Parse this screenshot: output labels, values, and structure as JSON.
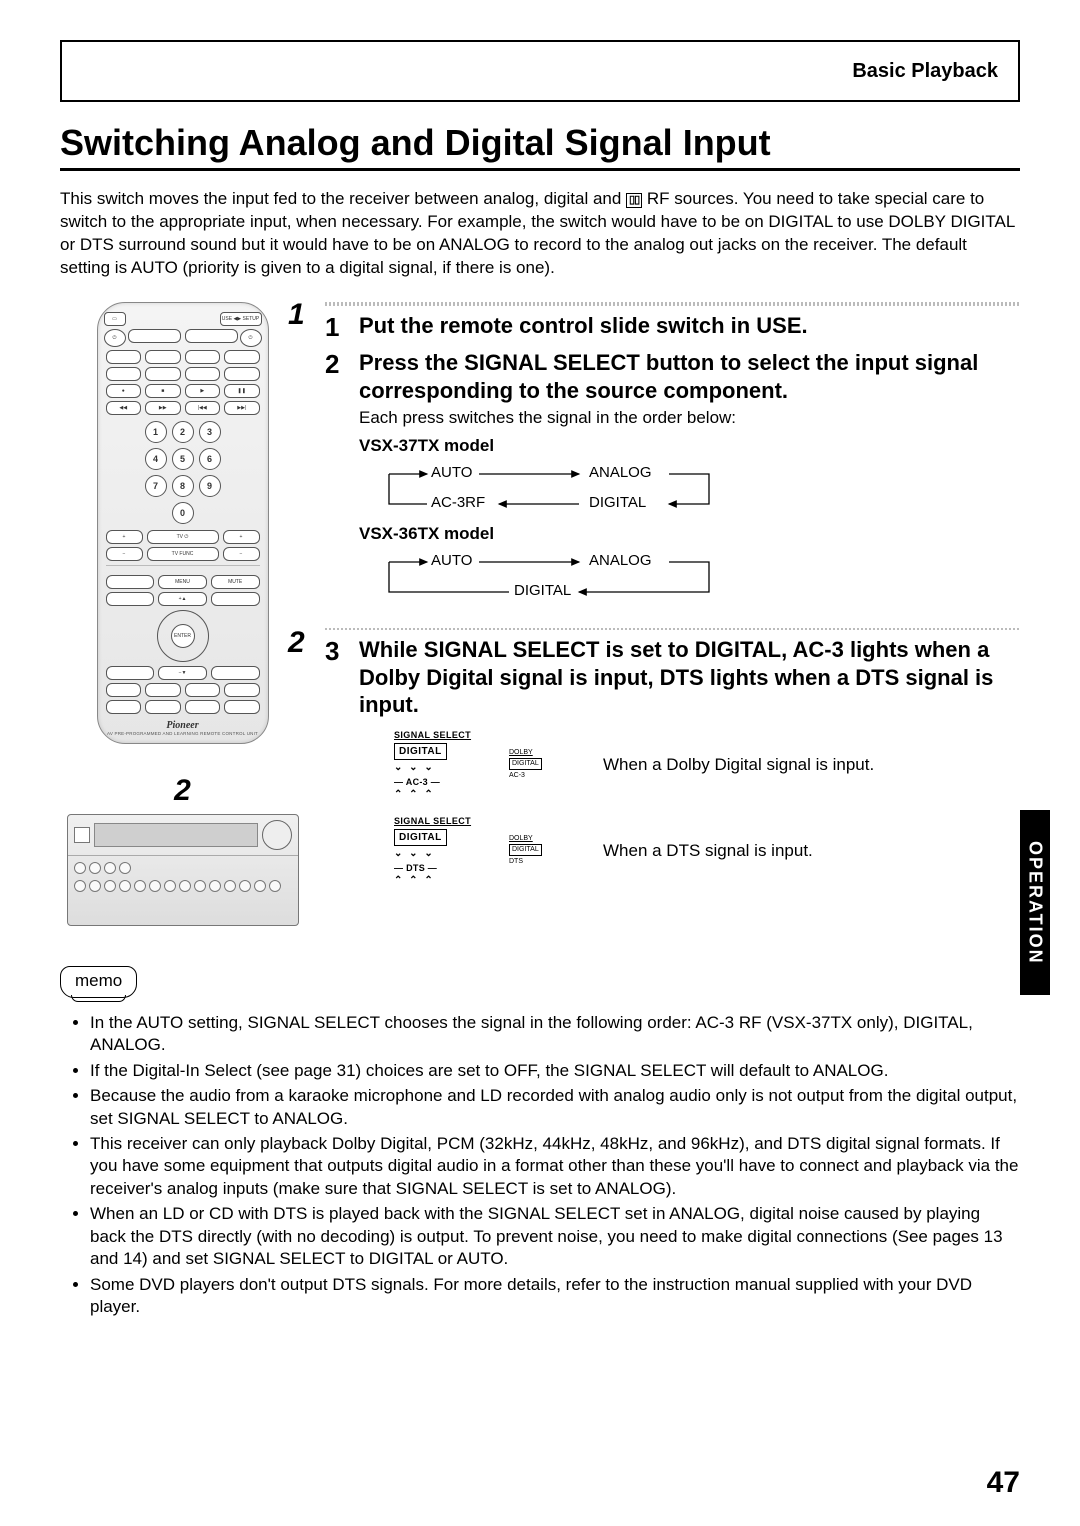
{
  "header": {
    "section": "Basic Playback"
  },
  "title": "Switching Analog and Digital Signal Input",
  "intro_parts": {
    "a": "This switch moves the input fed to the receiver between analog, digital and ",
    "dd": "▯▯",
    "b": " RF sources. You need to take special care to switch to the appropriate input, when necessary. For example, the switch would have to be on DIGITAL to use DOLBY DIGITAL or DTS surround sound but it would have to be on ANALOG to record to the analog out jacks on the receiver. The default setting is AUTO (priority is given to a digital signal, if there is one)."
  },
  "callouts": {
    "c1": "1",
    "c2": "2",
    "recv": "2"
  },
  "remote": {
    "logo": "Pioneer",
    "sub": "AV PRE-PROGRAMMED AND LEARNING REMOTE CONTROL UNIT",
    "nums": [
      "1",
      "2",
      "3",
      "4",
      "5",
      "6",
      "7",
      "8",
      "9",
      "0"
    ]
  },
  "steps": {
    "s1": {
      "n": "1",
      "title": "Put the remote control slide switch in USE."
    },
    "s2": {
      "n": "2",
      "title": "Press the SIGNAL SELECT button to select the input signal corresponding to the source component.",
      "sub": "Each press switches the signal in the order below:",
      "model37": "VSX-37TX model",
      "model36": "VSX-36TX model",
      "nodes37": {
        "auto": "AUTO",
        "analog": "ANALOG",
        "digital": "DIGITAL",
        "ac3rf": "AC-3RF"
      },
      "nodes36": {
        "auto": "AUTO",
        "analog": "ANALOG",
        "digital": "DIGITAL"
      }
    },
    "s3": {
      "n": "3",
      "title": "While SIGNAL SELECT is set to DIGITAL, AC-3 lights when a Dolby Digital signal is input, DTS lights when a DTS signal is input.",
      "ind1": {
        "select": "SIGNAL SELECT",
        "mode": "DIGITAL",
        "foot": "— AC-3 —",
        "side_top": "DIGITAL",
        "side_small": "AC-3",
        "text": "When a Dolby Digital signal is input."
      },
      "ind2": {
        "select": "SIGNAL SELECT",
        "mode": "DIGITAL",
        "foot": "— DTS —",
        "side_top": "DIGITAL",
        "side_small": "DTS",
        "text": "When a DTS signal is input."
      }
    }
  },
  "sidetab": "OPERATION",
  "memo_label": "memo",
  "memo": [
    "In the AUTO setting, SIGNAL SELECT chooses the signal in the following order: AC-3 RF (VSX-37TX only), DIGITAL, ANALOG.",
    "If the Digital-In Select (see page 31) choices are set to OFF, the SIGNAL SELECT will default to ANALOG.",
    "Because the audio from a karaoke microphone and LD recorded with analog audio only is not output from the digital output, set SIGNAL SELECT to ANALOG.",
    "This receiver can only playback Dolby Digital, PCM (32kHz, 44kHz, 48kHz, and  96kHz), and DTS digital signal formats. If you have some equipment that outputs digital audio in a format other than these you'll have to connect and playback via the receiver's analog inputs (make sure that SIGNAL SELECT is set to ANALOG).",
    "When an LD or CD with DTS is played back with the SIGNAL SELECT set in ANALOG, digital noise caused by playing back the DTS directly (with no decoding) is output. To prevent noise, you need to make digital connections (See pages 13 and 14) and set SIGNAL SELECT to DIGITAL or AUTO.",
    "Some DVD players don't output DTS signals. For more details, refer to the instruction manual supplied with your DVD player."
  ],
  "page_number": "47"
}
